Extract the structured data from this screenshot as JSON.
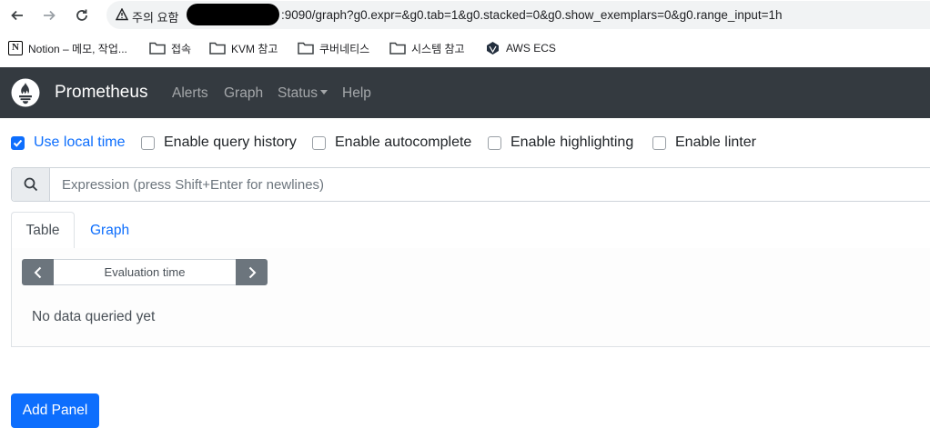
{
  "browser": {
    "security_text": "주의 요함",
    "url_visible": ":9090/graph?g0.expr=&g0.tab=1&g0.stacked=0&g0.show_exemplars=0&g0.range_input=1h",
    "bookmarks": [
      {
        "label": "Notion – 메모, 작업...",
        "icon": "notion-icon"
      },
      {
        "label": "접속",
        "icon": "folder-icon"
      },
      {
        "label": "KVM 참고",
        "icon": "folder-icon"
      },
      {
        "label": "쿠버네티스",
        "icon": "folder-icon"
      },
      {
        "label": "시스템 참고",
        "icon": "folder-icon"
      },
      {
        "label": "AWS ECS",
        "icon": "aws-ecs-icon"
      }
    ]
  },
  "navbar": {
    "brand": "Prometheus",
    "links": [
      "Alerts",
      "Graph",
      "Status",
      "Help"
    ],
    "bg_color": "#343a40"
  },
  "options": [
    {
      "label": "Use local time",
      "checked": true
    },
    {
      "label": "Enable query history",
      "checked": false
    },
    {
      "label": "Enable autocomplete",
      "checked": false
    },
    {
      "label": "Enable highlighting",
      "checked": false
    },
    {
      "label": "Enable linter",
      "checked": false
    }
  ],
  "expression": {
    "placeholder": "Expression (press Shift+Enter for newlines)",
    "value": ""
  },
  "tabs": {
    "table": "Table",
    "graph": "Graph",
    "active": "Table"
  },
  "table_panel": {
    "eval_placeholder": "Evaluation time",
    "empty_message": "No data queried yet"
  },
  "add_panel_label": "Add Panel",
  "accent_color": "#0d6efd"
}
